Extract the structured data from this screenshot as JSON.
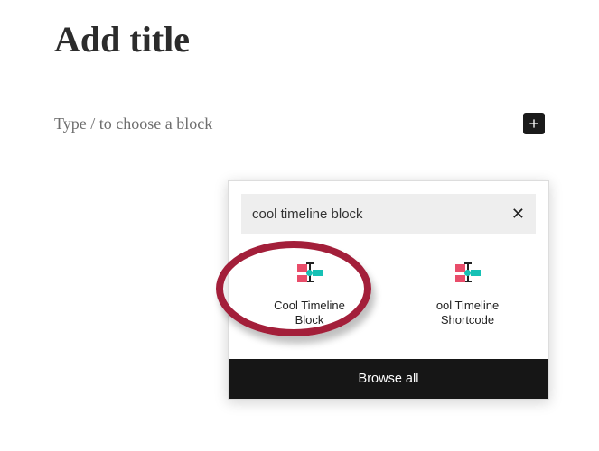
{
  "editor": {
    "title_placeholder": "Add title",
    "block_prompt": "Type / to choose a block"
  },
  "inserter": {
    "search_value": "cool timeline block",
    "results": [
      {
        "label": "Cool Timeline\nBlock"
      },
      {
        "label": "ool Timeline\nShortcode"
      }
    ],
    "browse_all_label": "Browse all"
  }
}
